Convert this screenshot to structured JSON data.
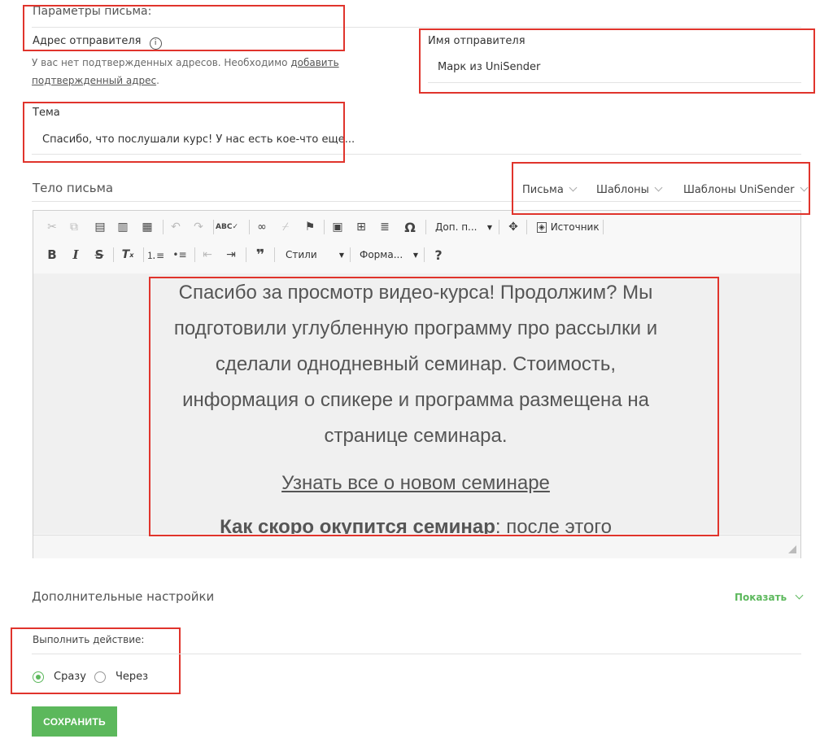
{
  "params_title": "Параметры письма:",
  "sender_address": {
    "label": "Адрес отправителя",
    "note_text": "У вас нет подтвержденных адресов. Необходимо ",
    "note_link": "добавить подтвержденный адрес",
    "note_end": "."
  },
  "sender_name": {
    "label": "Имя отправителя",
    "value": "Марк из UniSender"
  },
  "subject": {
    "label": "Тема",
    "value": "Спасибо, что послушали курс! У нас есть кое-что еще..."
  },
  "body": {
    "label": "Тело письма",
    "tabs": [
      "Письма",
      "Шаблоны",
      "Шаблоны UniSender"
    ]
  },
  "toolbar": {
    "more_label": "Доп. п...",
    "source_label": "Источник",
    "styles_label": "Стили",
    "format_label": "Форма...",
    "bold": "B",
    "italic": "I",
    "strike": "S",
    "quote": "❞",
    "help": "?",
    "omega": "Ω"
  },
  "content": {
    "para": "Спасибо за просмотр видео-курса! Продолжим? Мы подготовили углубленную программу про рассылки и сделали однодневный семинар. Стоимость, информация о спикере и программа размещена на странице семинара.",
    "link": "Узнать все о новом семинаре ",
    "last_bold": "Как скоро окупится семинар",
    "last_rest": ": после этого"
  },
  "additional": {
    "label": "Дополнительные настройки",
    "toggle": "Показать"
  },
  "action": {
    "label": "Выполнить действие:",
    "options": [
      "Сразу",
      "Через"
    ],
    "selected": "Сразу"
  },
  "save_label": "СОХРАНИТЬ",
  "colors": {
    "accent": "#5cb85c",
    "highlight": "#e0342c"
  }
}
